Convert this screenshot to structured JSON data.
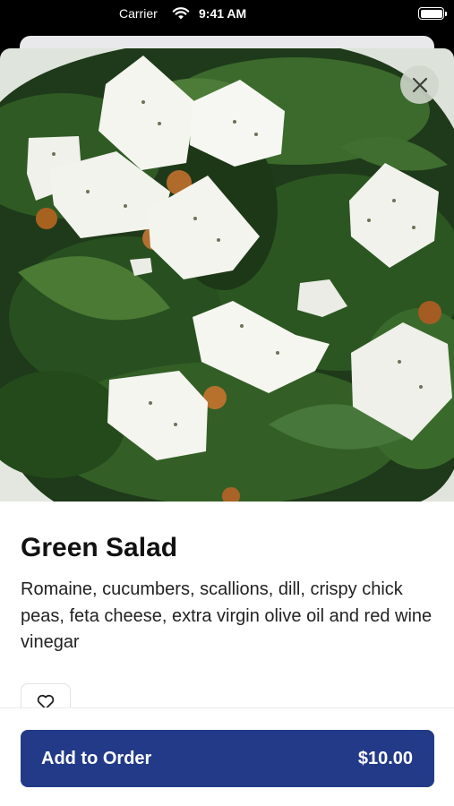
{
  "status_bar": {
    "carrier": "Carrier",
    "time": "9:41 AM"
  },
  "hero": {
    "image": "green-salad-photo",
    "close_icon": "close-icon"
  },
  "item": {
    "title": "Green Salad",
    "description": "Romaine, cucumbers, scallions, dill, crispy chick peas, feta cheese, extra virgin olive oil and red wine vinegar",
    "favorite_icon": "heart-outline-icon"
  },
  "order": {
    "label": "Add to Order",
    "price": "$10.00"
  },
  "colors": {
    "primary": "#223a87",
    "background": "#ffffff",
    "text": "#111111"
  }
}
